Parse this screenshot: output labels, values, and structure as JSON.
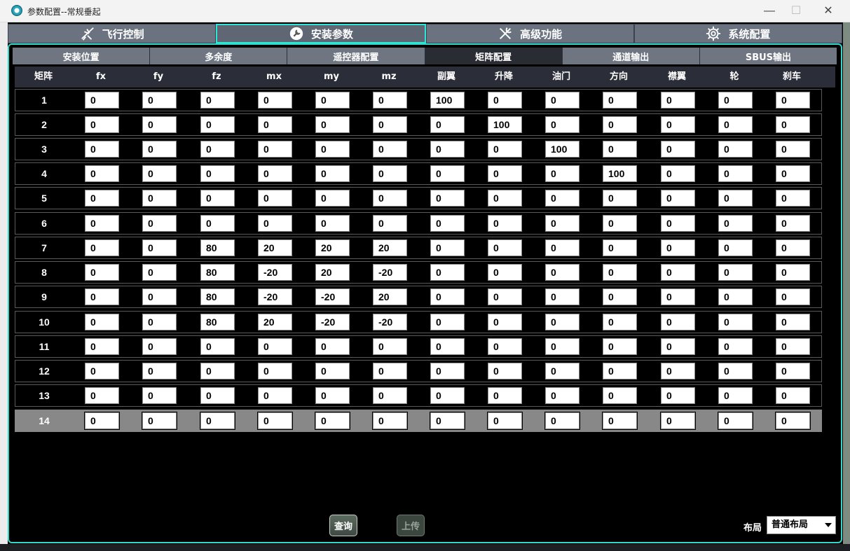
{
  "window": {
    "title": "参数配置--常规垂起",
    "minimize": "—",
    "maximize": "☐",
    "close": "✕"
  },
  "main_tabs": [
    {
      "label": "飞行控制",
      "icon": "airplane-icon"
    },
    {
      "label": "安装参数",
      "icon": "wrench-icon"
    },
    {
      "label": "高级功能",
      "icon": "tools-icon"
    },
    {
      "label": "系统配置",
      "icon": "gear-icon"
    }
  ],
  "sub_tabs": [
    "安装位置",
    "多余度",
    "遥控器配置",
    "矩阵配置",
    "通道输出",
    "SBUS输出"
  ],
  "columns": [
    "矩阵",
    "fx",
    "fy",
    "fz",
    "mx",
    "my",
    "mz",
    "副翼",
    "升降",
    "油门",
    "方向",
    "襟翼",
    "轮",
    "刹车"
  ],
  "rows": [
    {
      "label": "1",
      "values": [
        "0",
        "0",
        "0",
        "0",
        "0",
        "0",
        "100",
        "0",
        "0",
        "0",
        "0",
        "0",
        "0"
      ]
    },
    {
      "label": "2",
      "values": [
        "0",
        "0",
        "0",
        "0",
        "0",
        "0",
        "0",
        "100",
        "0",
        "0",
        "0",
        "0",
        "0"
      ]
    },
    {
      "label": "3",
      "values": [
        "0",
        "0",
        "0",
        "0",
        "0",
        "0",
        "0",
        "0",
        "100",
        "0",
        "0",
        "0",
        "0"
      ]
    },
    {
      "label": "4",
      "values": [
        "0",
        "0",
        "0",
        "0",
        "0",
        "0",
        "0",
        "0",
        "0",
        "100",
        "0",
        "0",
        "0"
      ]
    },
    {
      "label": "5",
      "values": [
        "0",
        "0",
        "0",
        "0",
        "0",
        "0",
        "0",
        "0",
        "0",
        "0",
        "0",
        "0",
        "0"
      ]
    },
    {
      "label": "6",
      "values": [
        "0",
        "0",
        "0",
        "0",
        "0",
        "0",
        "0",
        "0",
        "0",
        "0",
        "0",
        "0",
        "0"
      ]
    },
    {
      "label": "7",
      "values": [
        "0",
        "0",
        "80",
        "20",
        "20",
        "20",
        "0",
        "0",
        "0",
        "0",
        "0",
        "0",
        "0"
      ]
    },
    {
      "label": "8",
      "values": [
        "0",
        "0",
        "80",
        "-20",
        "20",
        "-20",
        "0",
        "0",
        "0",
        "0",
        "0",
        "0",
        "0"
      ]
    },
    {
      "label": "9",
      "values": [
        "0",
        "0",
        "80",
        "-20",
        "-20",
        "20",
        "0",
        "0",
        "0",
        "0",
        "0",
        "0",
        "0"
      ]
    },
    {
      "label": "10",
      "values": [
        "0",
        "0",
        "80",
        "20",
        "-20",
        "-20",
        "0",
        "0",
        "0",
        "0",
        "0",
        "0",
        "0"
      ]
    },
    {
      "label": "11",
      "values": [
        "0",
        "0",
        "0",
        "0",
        "0",
        "0",
        "0",
        "0",
        "0",
        "0",
        "0",
        "0",
        "0"
      ]
    },
    {
      "label": "12",
      "values": [
        "0",
        "0",
        "0",
        "0",
        "0",
        "0",
        "0",
        "0",
        "0",
        "0",
        "0",
        "0",
        "0"
      ]
    },
    {
      "label": "13",
      "values": [
        "0",
        "0",
        "0",
        "0",
        "0",
        "0",
        "0",
        "0",
        "0",
        "0",
        "0",
        "0",
        "0"
      ]
    },
    {
      "label": "14",
      "values": [
        "0",
        "0",
        "0",
        "0",
        "0",
        "0",
        "0",
        "0",
        "0",
        "0",
        "0",
        "0",
        "0"
      ]
    }
  ],
  "footer": {
    "query_label": "查询",
    "upload_label": "上传",
    "layout_label": "布局",
    "layout_value": "普通布局"
  },
  "colors": {
    "accent": "#2fe6d6",
    "tab_bg": "#6b7280",
    "selected_row": "#888888"
  }
}
